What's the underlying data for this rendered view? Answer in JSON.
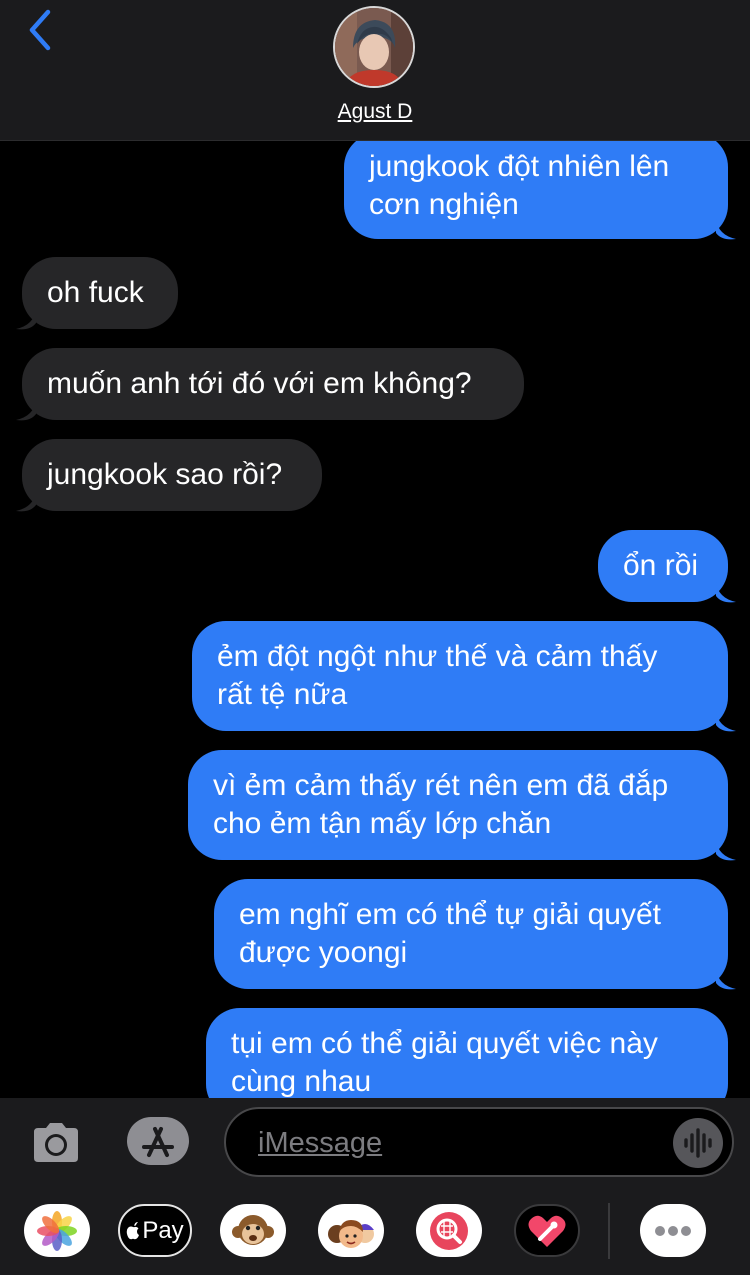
{
  "header": {
    "contact_name": "Agust D"
  },
  "messages": [
    {
      "direction": "outgoing",
      "text": "jungkook đột nhiên lên\ncơn nghiện"
    },
    {
      "direction": "incoming",
      "text": "oh fuck"
    },
    {
      "direction": "incoming",
      "text": "muốn anh tới đó với em không?"
    },
    {
      "direction": "incoming",
      "text": "jungkook sao rồi?"
    },
    {
      "direction": "outgoing",
      "text": "ổn rồi"
    },
    {
      "direction": "outgoing",
      "text": "ẻm đột ngột như thế và cảm thấy\nrất tệ nữa"
    },
    {
      "direction": "outgoing",
      "text": "vì ẻm cảm thấy rét nên em đã đắp\ncho ẻm tận mấy lớp chăn"
    },
    {
      "direction": "outgoing",
      "text": "em nghĩ em có thể tự giải quyết\nđược yoongi"
    },
    {
      "direction": "outgoing",
      "text": "tụi em có thể giải quyết việc này\ncùng nhau"
    }
  ],
  "input": {
    "placeholder": "iMessage"
  },
  "app_drawer": {
    "items": [
      {
        "icon": "photos-icon"
      },
      {
        "icon": "apple-pay-icon",
        "label": "Pay"
      },
      {
        "icon": "animoji-monkey-icon"
      },
      {
        "icon": "memoji-stickers-icon"
      },
      {
        "icon": "gif-search-icon"
      },
      {
        "icon": "digital-touch-icon"
      },
      {
        "icon": "more-apps-icon"
      }
    ]
  },
  "colors": {
    "outgoing_bubble": "#2f7cf6",
    "incoming_bubble": "#262628",
    "background": "#000000",
    "bar_background": "#1b1b1d",
    "accent": "#2f7cf6"
  }
}
